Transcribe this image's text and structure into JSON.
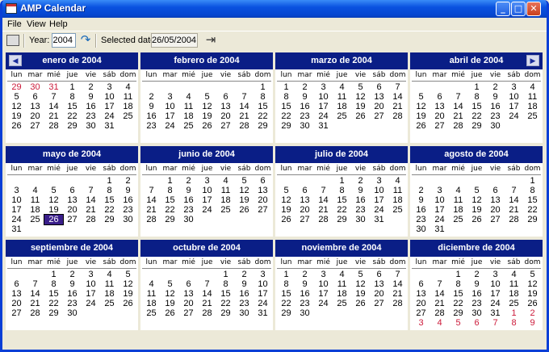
{
  "window": {
    "title": "AMP Calendar"
  },
  "menu": [
    "File",
    "View",
    "Help"
  ],
  "toolbar": {
    "year_label": "Year:",
    "year_value": "2004",
    "selected_label": "Selected date:",
    "selected_value": "26/05/2004"
  },
  "weekdays": [
    "lun",
    "mar",
    "mié",
    "jue",
    "vie",
    "sáb",
    "dom"
  ],
  "months": [
    {
      "title": "enero de 2004",
      "startDow": 3,
      "days": 31,
      "leading": [
        29,
        30,
        31
      ],
      "trailing": [],
      "selected": null
    },
    {
      "title": "febrero de 2004",
      "startDow": 6,
      "days": 29,
      "leading": [],
      "trailing": [],
      "selected": null
    },
    {
      "title": "marzo de 2004",
      "startDow": 0,
      "days": 31,
      "leading": [],
      "trailing": [],
      "selected": null
    },
    {
      "title": "abril de 2004",
      "startDow": 3,
      "days": 30,
      "leading": [],
      "trailing": [],
      "selected": null
    },
    {
      "title": "mayo de 2004",
      "startDow": 5,
      "days": 31,
      "leading": [],
      "trailing": [],
      "selected": 26
    },
    {
      "title": "junio de 2004",
      "startDow": 1,
      "days": 30,
      "leading": [],
      "trailing": [],
      "selected": null
    },
    {
      "title": "julio de 2004",
      "startDow": 3,
      "days": 31,
      "leading": [],
      "trailing": [],
      "selected": null
    },
    {
      "title": "agosto de 2004",
      "startDow": 6,
      "days": 31,
      "leading": [],
      "trailing": [],
      "selected": null
    },
    {
      "title": "septiembre de 2004",
      "startDow": 2,
      "days": 30,
      "leading": [],
      "trailing": [],
      "selected": null
    },
    {
      "title": "octubre de 2004",
      "startDow": 4,
      "days": 31,
      "leading": [],
      "trailing": [],
      "selected": null
    },
    {
      "title": "noviembre de 2004",
      "startDow": 0,
      "days": 30,
      "leading": [],
      "trailing": [],
      "selected": null
    },
    {
      "title": "diciembre de 2004",
      "startDow": 2,
      "days": 31,
      "leading": [],
      "trailing": [
        1,
        2,
        3,
        4,
        5,
        6,
        7,
        8,
        9
      ],
      "selected": null
    }
  ],
  "nav": {
    "prev": "◀",
    "next": "▶"
  },
  "colors": {
    "header": "#0a1e86",
    "other_month_day": "#cc1a3a",
    "selected_day": "#3a1e8a"
  }
}
